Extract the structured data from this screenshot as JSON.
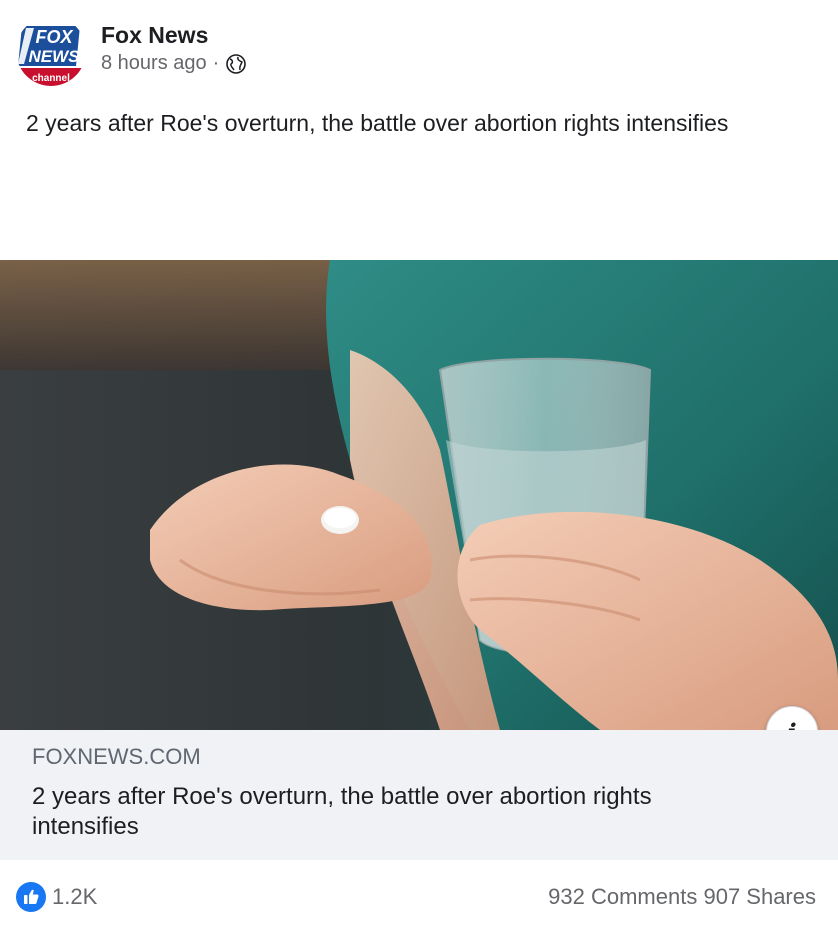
{
  "post": {
    "page_name": "Fox News",
    "time_ago": "8 hours ago",
    "separator": "·",
    "privacy_icon": "globe-icon",
    "text": "2 years after Roe's overturn, the battle over abortion rights intensifies",
    "logo": {
      "line1": "FOX",
      "line2": "NEWS",
      "line3": "channel"
    }
  },
  "media": {
    "description_icon": "info-icon",
    "info_glyph": "i"
  },
  "link_card": {
    "domain": "FOXNEWS.COM",
    "title": "2 years after Roe's overturn, the battle over abortion rights intensifies"
  },
  "footer": {
    "reaction_icon": "like-icon",
    "reaction_count": "1.2K",
    "comments": "932 Comments",
    "shares": "907 Shares"
  },
  "colors": {
    "facebook_blue": "#1877f2",
    "secondary_text": "#65676b",
    "fox_red": "#c8102e",
    "fox_blue": "#1b4f9c"
  }
}
